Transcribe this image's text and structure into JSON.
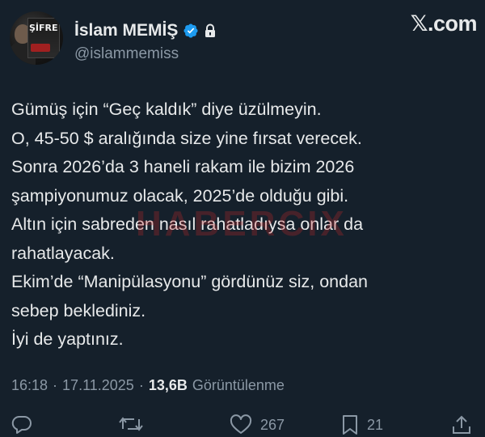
{
  "author": {
    "display_name": "İslam MEMİŞ",
    "handle": "@islammemiss",
    "avatar_book_title": "ŞİFRE"
  },
  "brand": {
    "label": "𝕏.com"
  },
  "tweet": {
    "lines": [
      "Gümüş için “Geç kaldık” diye üzülmeyin.",
      "O, 45-50 $ aralığında size yine fırsat verecek.",
      "Sonra 2026’da 3 haneli rakam ile bizim 2026",
      "şampiyonumuz olacak, 2025’de olduğu gibi.",
      "Altın için sabreden nasıl rahatladıysa onlar da",
      "rahatlayacak.",
      "Ekim’de “Manipülasyonu” gördünüz siz, ondan",
      "sebep beklediniz.",
      "İyi de yaptınız."
    ]
  },
  "watermark": {
    "text": "HABERCIX"
  },
  "meta": {
    "time": "16:18",
    "separator": "·",
    "date": "17.11.2025",
    "views_count": "13,6B",
    "views_label": "Görüntülenme"
  },
  "actions": {
    "likes": "267",
    "bookmarks": "21"
  },
  "colors": {
    "background": "#15202b",
    "text": "#e7e9ea",
    "muted": "#8b98a5",
    "verified": "#1d9bf0",
    "watermark": "#c82828"
  },
  "icons": [
    "verified-badge-icon",
    "lock-icon",
    "reply-icon",
    "retweet-icon",
    "like-icon",
    "bookmark-icon",
    "share-icon"
  ]
}
